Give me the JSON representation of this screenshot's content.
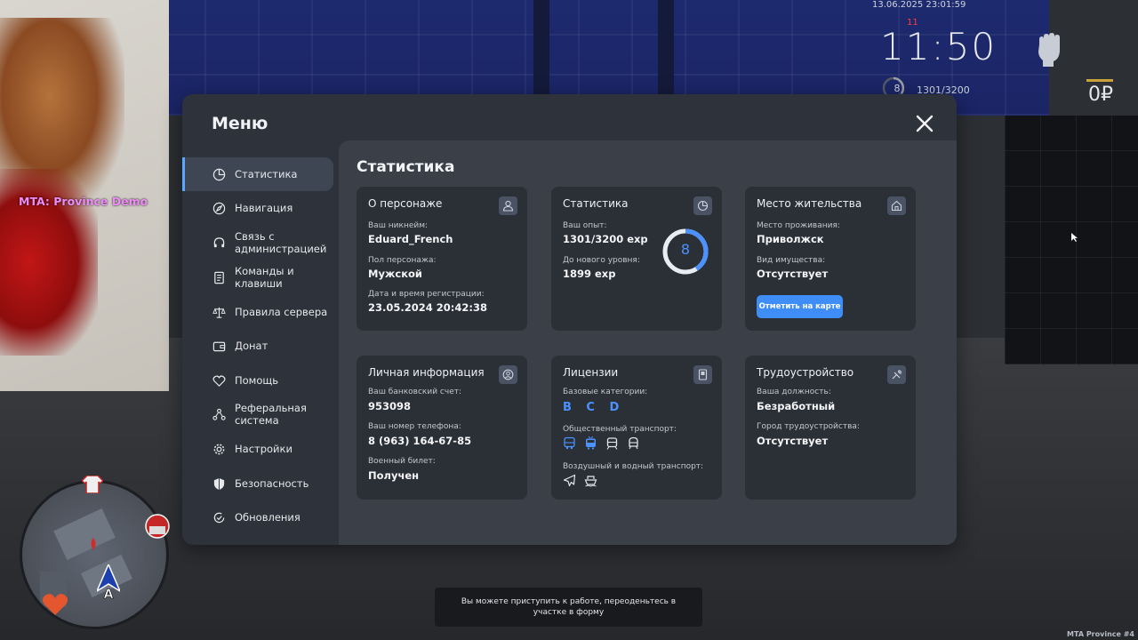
{
  "hud": {
    "datetime": "13.06.2025 23:01:59",
    "alert": "11",
    "clock": "11:50",
    "level": "8",
    "exp": "1301/3200",
    "money": "0₽",
    "fist_icon": "fist-icon"
  },
  "server_tag": "MTA: Province Demo",
  "menu": {
    "title": "Меню",
    "nav": [
      {
        "label": "Статистика",
        "icon": "pie-chart-icon"
      },
      {
        "label": "Навигация",
        "icon": "compass-icon"
      },
      {
        "label": "Связь с администрацией",
        "icon": "headset-icon"
      },
      {
        "label": "Команды и клавиши",
        "icon": "document-icon"
      },
      {
        "label": "Правила сервера",
        "icon": "scales-icon"
      },
      {
        "label": "Донат",
        "icon": "wallet-icon"
      },
      {
        "label": "Помощь",
        "icon": "heart-handshake-icon"
      },
      {
        "label": "Реферальная система",
        "icon": "network-icon"
      },
      {
        "label": "Настройки",
        "icon": "gear-icon"
      },
      {
        "label": "Безопасность",
        "icon": "shield-icon"
      },
      {
        "label": "Обновления",
        "icon": "refresh-check-icon"
      }
    ],
    "active_index": 0
  },
  "content": {
    "title": "Статистика",
    "character": {
      "title": "О персонаже",
      "nickname_label": "Ваш никнейм:",
      "nickname": "Eduard_French",
      "gender_label": "Пол персонажа:",
      "gender": "Мужской",
      "reg_label": "Дата и время регистрации:",
      "reg": "23.05.2024 20:42:38"
    },
    "stats": {
      "title": "Статистика",
      "exp_label": "Ваш опыт:",
      "exp": "1301/3200 exp",
      "next_label": "До нового уровня:",
      "next": "1899 exp",
      "level": "8",
      "progress": 0.41
    },
    "residence": {
      "title": "Место жительства",
      "place_label": "Место проживания:",
      "place": "Приволжск",
      "property_label": "Вид имущества:",
      "property": "Отсутствует",
      "map_button": "Отметить на карте"
    },
    "personal": {
      "title": "Личная информация",
      "bank_label": "Ваш банковский счет:",
      "bank": "953098",
      "phone_label": "Ваш номер телефона:",
      "phone": "8 (963) 164-67-85",
      "military_label": "Военный билет:",
      "military": "Получен"
    },
    "licenses": {
      "title": "Лицензии",
      "base_label": "Базовые категории:",
      "base": "B C D",
      "public_label": "Общественный транспорт:",
      "public_icons": [
        "bus-icon",
        "trolleybus-icon",
        "tram-icon",
        "metro-icon"
      ],
      "air_label": "Воздушный и водный транспорт:",
      "air_icons": [
        "plane-icon",
        "ship-icon"
      ]
    },
    "employment": {
      "title": "Трудоустройство",
      "position_label": "Ваша должность:",
      "position": "Безработный",
      "city_label": "Город трудоустройства:",
      "city": "Отсутствует"
    }
  },
  "notice": "Вы можете приступить к работе, переоденьтесь в участке в форму",
  "watermark": "MTA Province #4",
  "colors": {
    "accent": "#4b92ff",
    "button": "#3f8ef7",
    "panel": "#2e323a",
    "content": "#3a3f48",
    "card": "#2b2f36"
  }
}
